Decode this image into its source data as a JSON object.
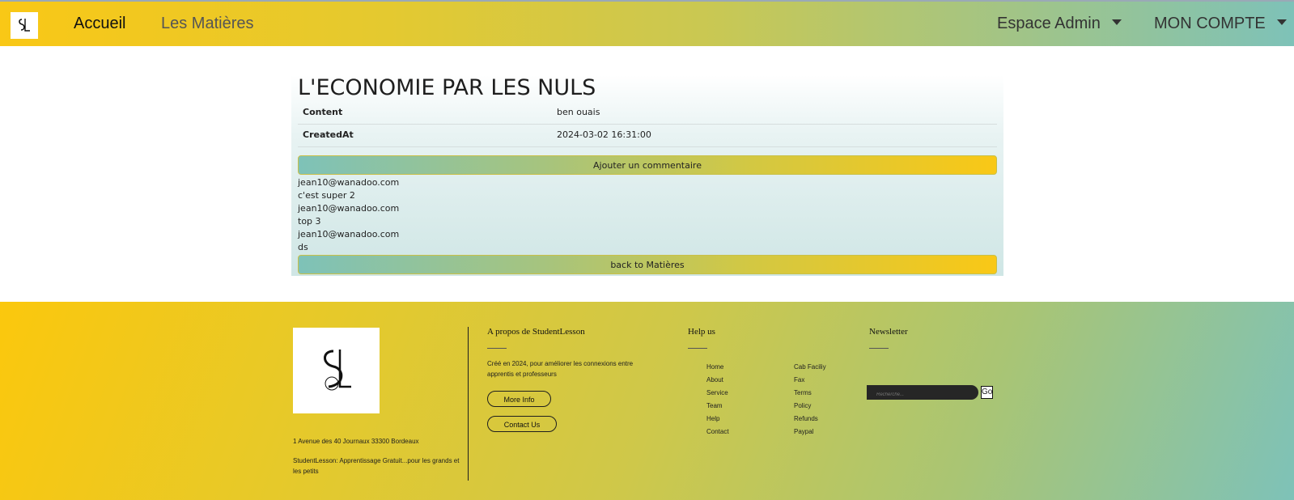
{
  "navbar": {
    "logo_icon": "sl-logo-icon",
    "home": "Accueil",
    "subjects": "Les Matières",
    "admin": "Espace Admin",
    "account": "MON COMPTE"
  },
  "article": {
    "title": "L'ECONOMIE PAR LES NULS",
    "rows": [
      {
        "key": "Content",
        "value": "ben ouais"
      },
      {
        "key": "CreatedAt",
        "value": "2024-03-02 16:31:00"
      }
    ],
    "add_comment_label": "Ajouter un commentaire",
    "comments": [
      {
        "author": "jean10@wanadoo.com",
        "text": "c'est super 2"
      },
      {
        "author": "jean10@wanadoo.com",
        "text": "top 3"
      },
      {
        "author": "jean10@wanadoo.com",
        "text": "ds"
      }
    ],
    "back_label": "back to Matières"
  },
  "footer": {
    "address": "1 Avenue des 40 Journaux 33300 Bordeaux",
    "tagline": "StudentLesson: Apprentissage Gratuit...pour les grands et les petits",
    "about_title": "A propos de StudentLesson",
    "about_text": "Créé en 2024, pour améliorer les connexions entre apprentis et professeurs",
    "more_info": "More Info",
    "contact_us": "Contact Us",
    "help_title": "Help us",
    "help_col1": [
      "Home",
      "About",
      "Service",
      "Team",
      "Help",
      "Contact"
    ],
    "help_col2": [
      "Cab Faciliy",
      "Fax",
      "Terms",
      "Policy",
      "Refunds",
      "Paypal"
    ],
    "newsletter_title": "Newsletter",
    "search_placeholder": "Recherche...",
    "go_label": "Go"
  },
  "colors": {
    "yellow": "#f9c816",
    "teal": "#7ec2b8"
  }
}
